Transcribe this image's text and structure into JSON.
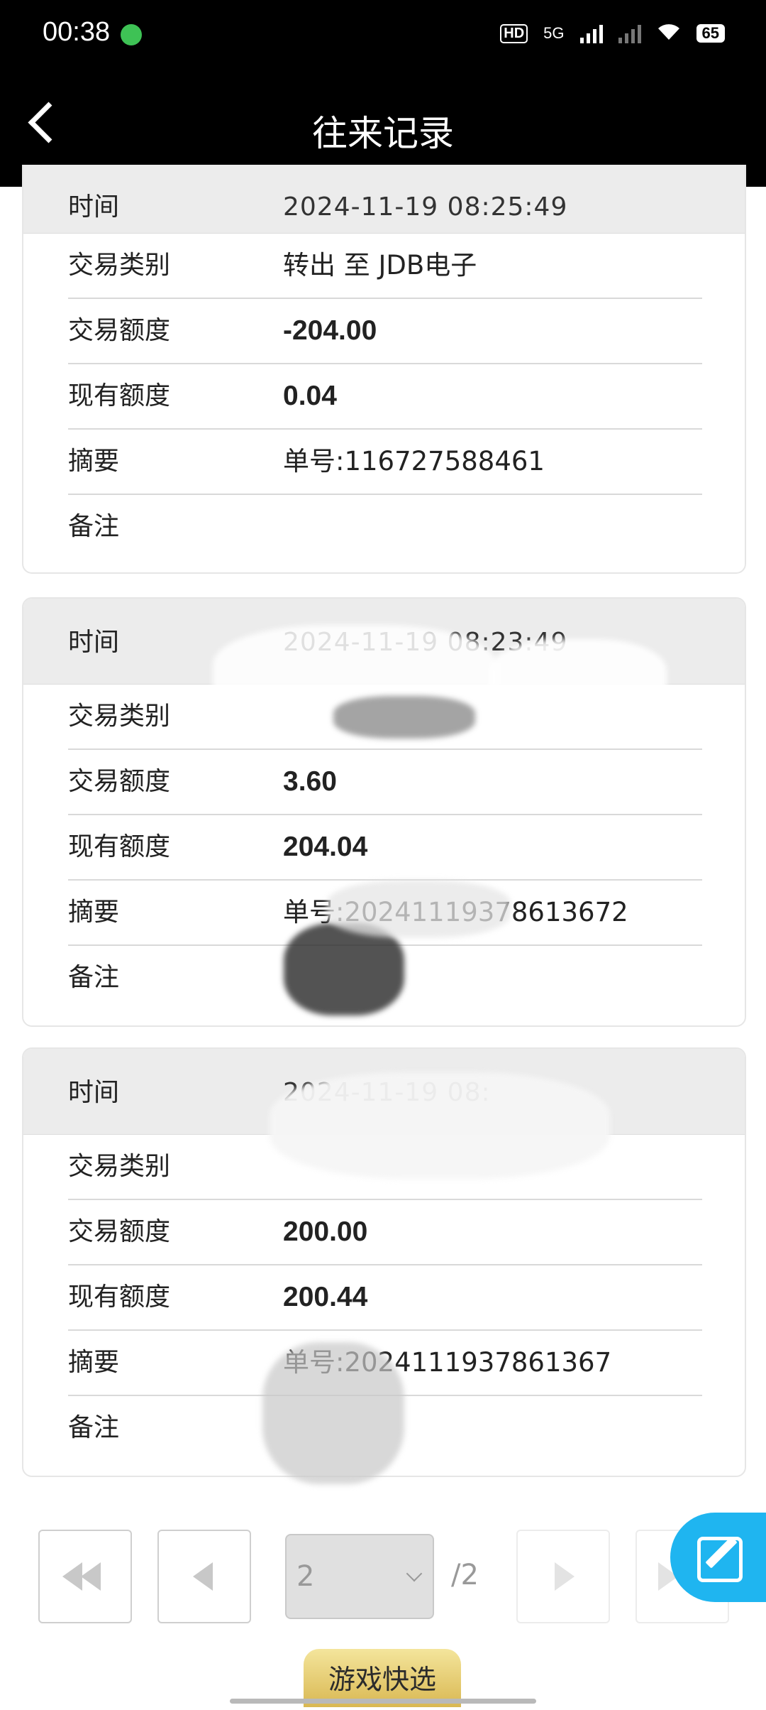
{
  "status_bar": {
    "time": "00:38",
    "hd": "HD",
    "network": "5G",
    "battery": "65"
  },
  "header": {
    "title": "往来记录"
  },
  "labels": {
    "time": "时间",
    "type": "交易类别",
    "amount": "交易额度",
    "balance": "现有额度",
    "summary": "摘要",
    "note": "备注"
  },
  "records": [
    {
      "time": "2024-11-19 08:25:49",
      "type": "转出 至 JDB电子",
      "amount": "-204.00",
      "balance": "0.04",
      "summary": "单号:116727588461",
      "note": ""
    },
    {
      "time": "2024-11-19 08:23:49",
      "type": "",
      "amount": "3.60",
      "balance": "204.04",
      "summary": "单号:20241119378613672",
      "note": ""
    },
    {
      "time": "2024-11-19 08:",
      "type": "",
      "amount": "200.00",
      "balance": "200.44",
      "summary": "单号:2024111937861367",
      "note": ""
    }
  ],
  "pagination": {
    "current_page": "2",
    "total": "/2"
  },
  "quick_button": "游戏快选",
  "colors": {
    "header_bg": "#000000",
    "fab": "#1fb5f0",
    "quick_button": "#e4c96a"
  }
}
